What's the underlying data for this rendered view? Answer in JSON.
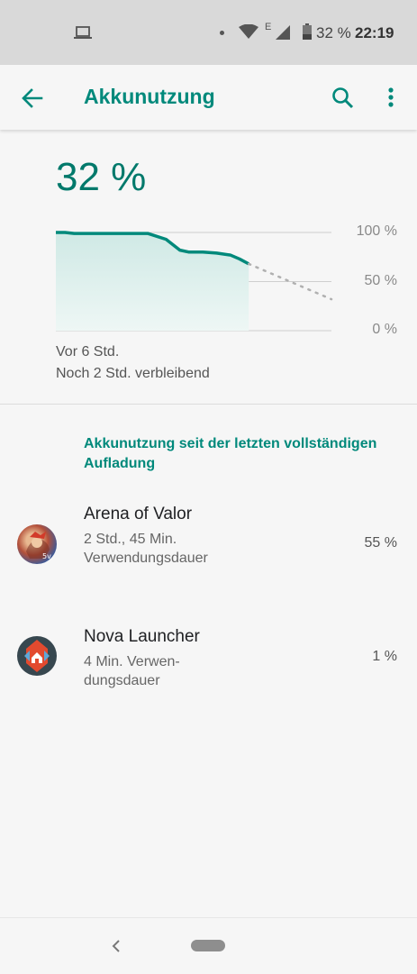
{
  "status_bar": {
    "battery_percent": "32 %",
    "time": "22:19",
    "network_type": "E",
    "icons": [
      "laptop-icon",
      "notification-dot-icon",
      "wifi-icon",
      "signal-icon",
      "battery-icon"
    ]
  },
  "app_bar": {
    "title": "Akkunutzung",
    "back_icon": "arrow-back-icon",
    "search_icon": "search-icon",
    "more_icon": "more-vert-icon"
  },
  "summary": {
    "current_level": "32 %",
    "since": "Vor 6 Std.",
    "remaining": "Noch 2 Std. verbleibend"
  },
  "chart_data": {
    "type": "area",
    "x": [
      0,
      0.1,
      0.2,
      0.4,
      0.7,
      1.0,
      1.2,
      1.35,
      1.45,
      1.6,
      1.75,
      1.9,
      2.0,
      2.1
    ],
    "y": [
      100,
      100,
      99,
      99,
      99,
      99,
      93,
      82,
      80,
      80,
      79,
      77,
      73,
      68
    ],
    "x_projected": [
      2.1,
      3.0
    ],
    "y_projected": [
      68,
      32
    ],
    "ylim": [
      0,
      100
    ],
    "y_ticks": [
      "100 %",
      "50 %",
      "0 %"
    ],
    "grid": true,
    "colors": {
      "line": "#00897b",
      "fill": "#cfe9e5",
      "projection": "#b0b0b0",
      "grid": "#cfcfcf"
    }
  },
  "section": {
    "title": "Akkunutzung seit der letzten vollständigen Aufladung"
  },
  "apps": [
    {
      "name": "Arena of Valor",
      "usage": "2 Std., 45 Min. Verwendungs­dauer",
      "percent": "55 %",
      "icon": "arena-of-valor-icon"
    },
    {
      "name": "Nova Launcher",
      "usage": "4 Min. Verwen­dungsdauer",
      "percent": "1 %",
      "icon": "nova-launcher-icon"
    }
  ],
  "nav_bar": {
    "back_icon": "nav-back-icon",
    "home_icon": "nav-home-pill-icon"
  },
  "colors": {
    "accent": "#00897b",
    "background": "#f6f6f6",
    "status_bar": "#d9d9d9"
  }
}
